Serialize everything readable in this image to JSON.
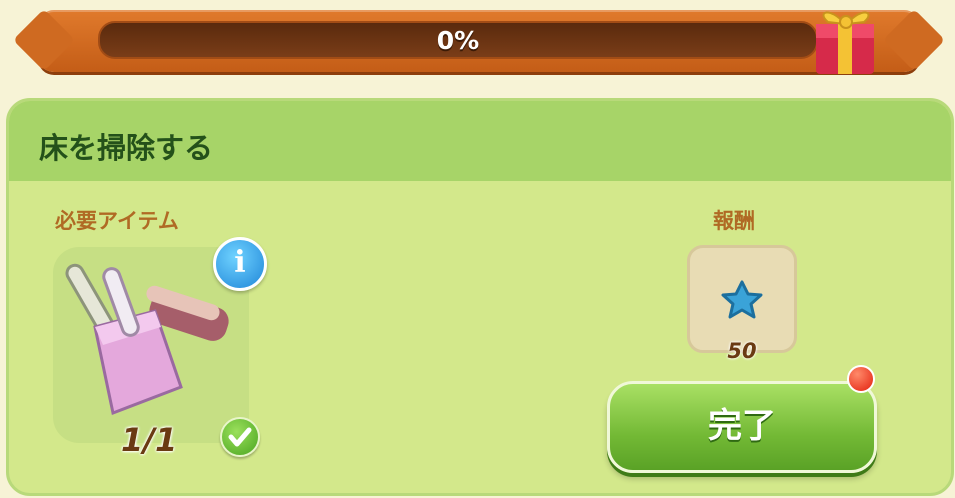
{
  "progress": {
    "percent_text": "0%",
    "value": 0
  },
  "task": {
    "title": "床を掃除する",
    "required_label": "必要アイテム",
    "reward_label": "報酬",
    "item": {
      "icon": "broom-and-dustpan-icon",
      "count_text": "1/1"
    },
    "reward": {
      "icon": "blue-star-icon",
      "amount": "50"
    },
    "complete_button": "完了"
  },
  "colors": {
    "banner": "#d86f25",
    "panel": "#d3e88b",
    "panel_header": "#a7d468",
    "button": "#73b935",
    "notification": "#e3200e"
  }
}
